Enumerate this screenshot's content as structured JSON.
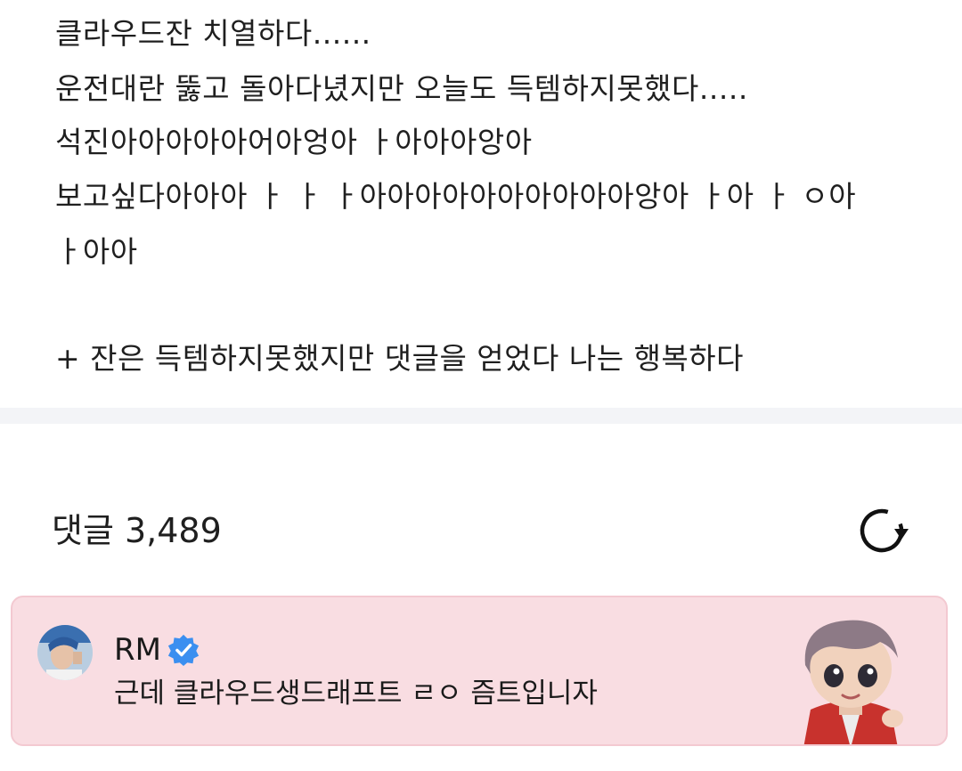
{
  "post": {
    "lines": [
      "클라우드잔 치열하다......",
      "운전대란 뚫고 돌아다녔지만 오늘도 득템하지못했다.....",
      "석진아아아아아어아엉아 ㅏ아아아앙아",
      "보고싶다아아아 ㅏ ㅏ ㅏ아아아아아아아아아아앙아 ㅏ아 ㅏ ㅇ아",
      "ㅏ아아",
      "+ 잔은 득템하지못했지만 댓글을 얻었다 나는 행복하다"
    ]
  },
  "comments": {
    "title": "댓글 3,489",
    "refresh_icon": "refresh-icon"
  },
  "pinned_comment": {
    "author": "RM",
    "verified_icon": "verified-badge-icon",
    "text": "근데 클라우드생드래프트 ㄹㅇ 즘트입니자",
    "accent_color": "#f9dde2",
    "badge_color": "#3b8ff0"
  }
}
